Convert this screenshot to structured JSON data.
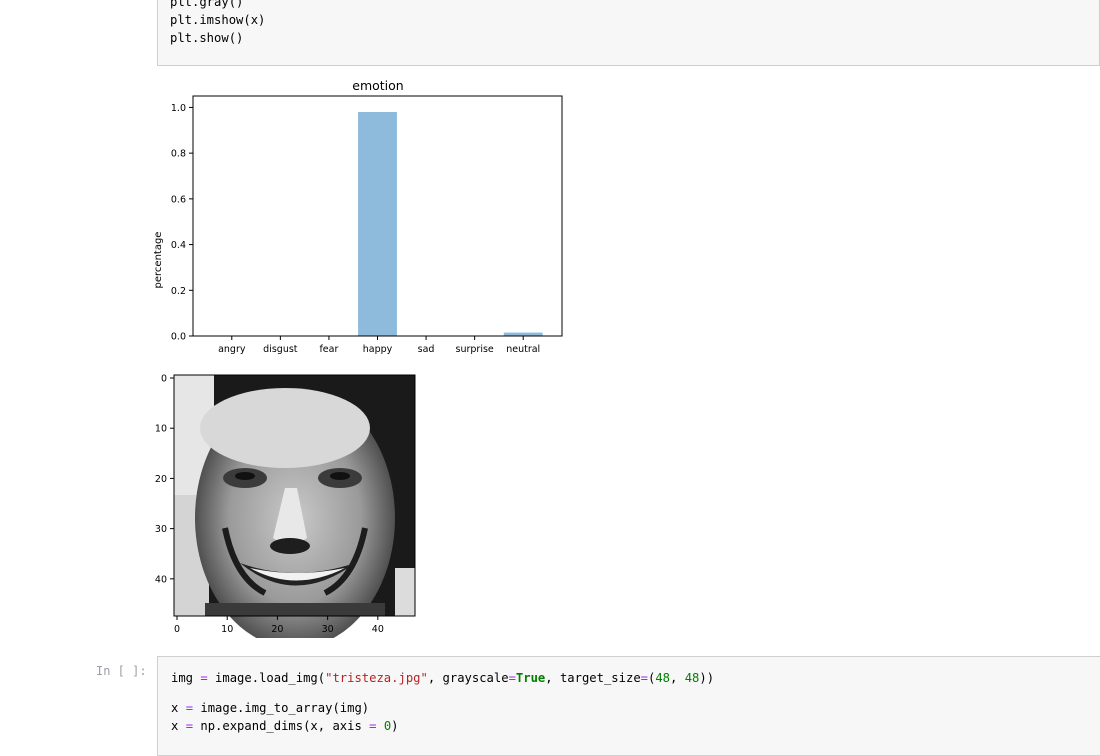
{
  "top_cell": {
    "lines": [
      "plt.gray()",
      "plt.imshow(x)",
      "plt.show()"
    ]
  },
  "chart_data": [
    {
      "type": "bar",
      "title": "emotion",
      "xlabel": "",
      "ylabel": "percentage",
      "categories": [
        "angry",
        "disgust",
        "fear",
        "happy",
        "sad",
        "surprise",
        "neutral"
      ],
      "values": [
        0.0,
        0.0,
        0.0,
        0.98,
        0.0,
        0.0,
        0.015
      ],
      "ylim": [
        0,
        1.05
      ],
      "yticks": [
        "0.0",
        "0.2",
        "0.4",
        "0.6",
        "0.8",
        "1.0"
      ],
      "bar_color": "#8ebadb",
      "grid": false
    },
    {
      "type": "heatmap",
      "title": "",
      "description_value": "48x48 grayscale face image",
      "xticks": [
        "0",
        "10",
        "20",
        "30",
        "40"
      ],
      "yticks": [
        "0",
        "10",
        "20",
        "30",
        "40"
      ],
      "xlim": [
        0,
        48
      ],
      "ylim": [
        48,
        0
      ]
    }
  ],
  "bottom_cell": {
    "prompt": "In [ ]:",
    "line1": {
      "a": "img ",
      "eq1": "=",
      "b": " image.load_img(",
      "str": "\"tristeza.jpg\"",
      "c": ", grayscale",
      "eq2": "=",
      "kw": "True",
      "d": ", target_size",
      "eq3": "=",
      "e": "(",
      "n1": "48",
      "f": ", ",
      "n2": "48",
      "g": "))"
    },
    "line2": {
      "a": "x ",
      "eq": "=",
      "b": " image.img_to_array(img)"
    },
    "line3": {
      "a": "x ",
      "eq1": "=",
      "b": " np.expand_dims(x, axis ",
      "eq2": "=",
      "c": " ",
      "n": "0",
      "d": ")"
    }
  }
}
